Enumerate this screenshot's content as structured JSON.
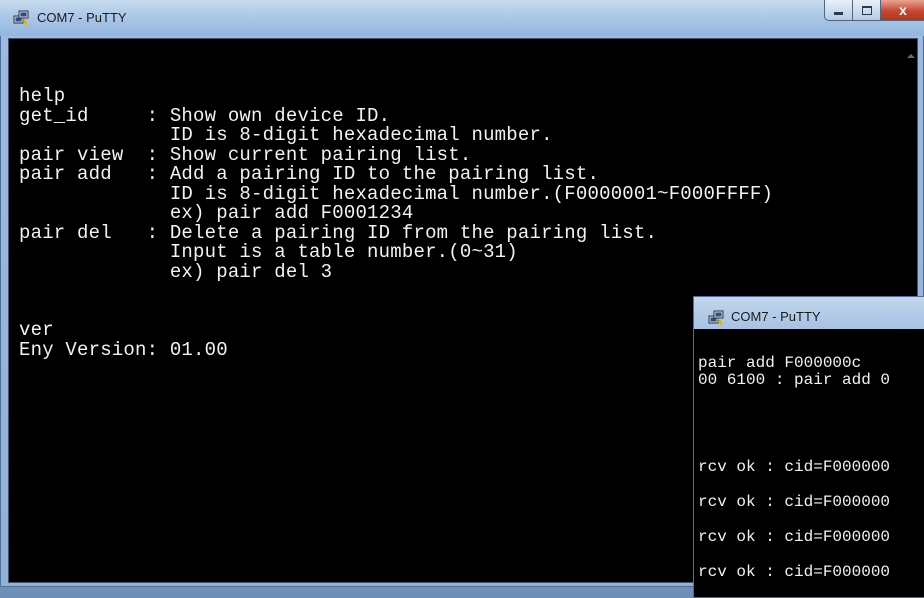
{
  "main_window": {
    "title": "COM7 - PuTTY",
    "close_label": "x",
    "lines": [
      "help",
      "get_id     : Show own device ID.",
      "             ID is 8-digit hexadecimal number.",
      "pair view  : Show current pairing list.",
      "pair add   : Add a pairing ID to the pairing list.",
      "             ID is 8-digit hexadecimal number.(F0000001~F000FFFF)",
      "             ex) pair add F0001234",
      "pair del   : Delete a pairing ID from the pairing list.",
      "             Input is a table number.(0~31)",
      "             ex) pair del 3",
      "",
      "",
      "ver",
      "Eny Version: 01.00"
    ]
  },
  "second_window": {
    "title": "COM7 - PuTTY",
    "lines": [
      "pair add F000000c",
      "00 6100 : pair add 0",
      "rcv ok : cid=F000000",
      "rcv ok : cid=F000000",
      "rcv ok : cid=F000000",
      "rcv ok : cid=F000000"
    ]
  }
}
